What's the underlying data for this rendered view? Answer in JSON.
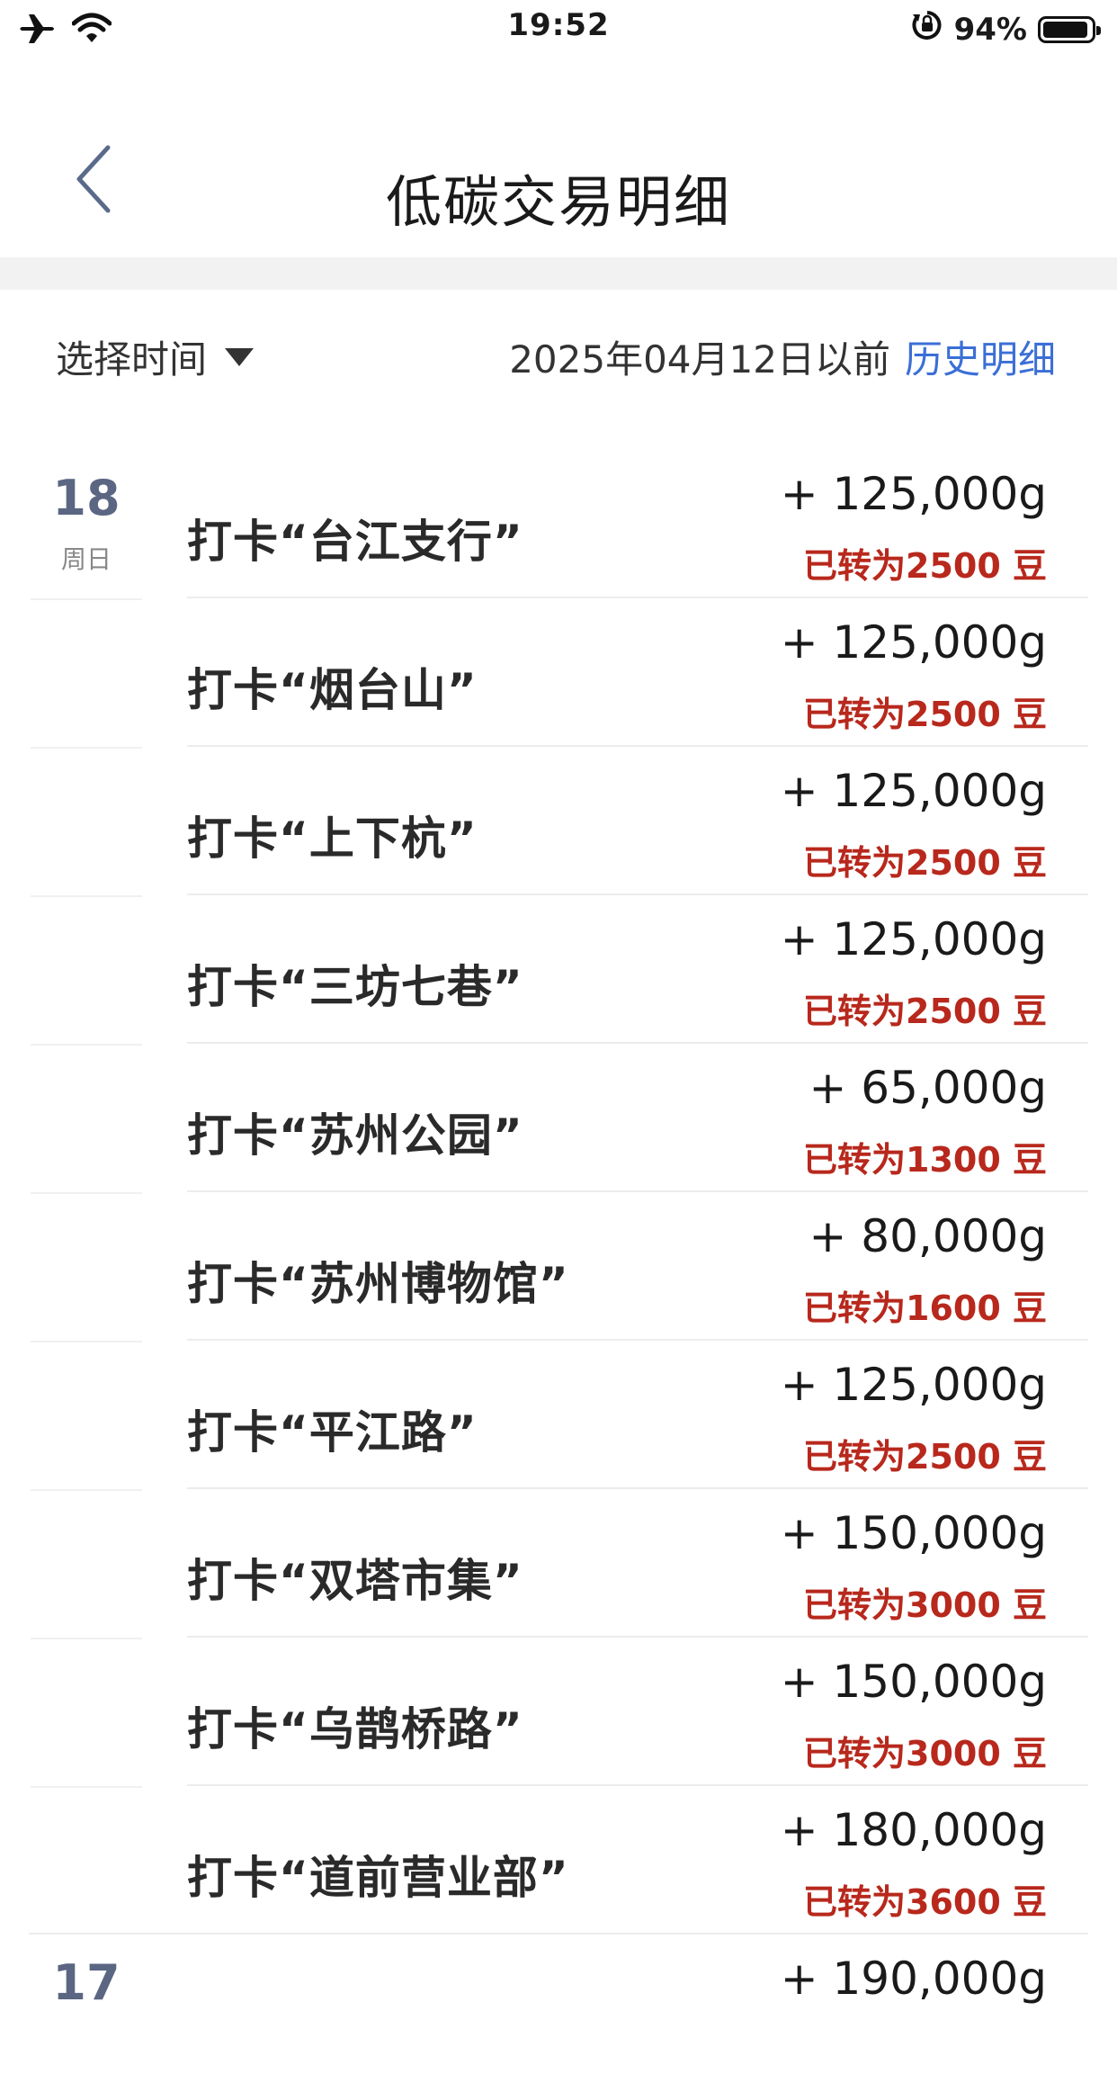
{
  "status_bar": {
    "time": "19:52",
    "battery_text": "94%",
    "battery_level": 0.94,
    "icons": [
      "airplane-icon",
      "wifi-icon",
      "orientation-lock-icon",
      "battery-icon"
    ]
  },
  "nav": {
    "title": "低碳交易明细",
    "back_icon": "chevron-left-icon"
  },
  "filter": {
    "select_label": "选择时间",
    "date_text": "2025年04月12日以前",
    "history_link": "历史明细"
  },
  "colors": {
    "accent_blue": "#3b6fd6",
    "bean_red": "#b8281c",
    "date_gray_blue": "#5b6683"
  },
  "groups": [
    {
      "day": "18",
      "weekday": "周日",
      "items": [
        {
          "title": "打卡“台江支行”",
          "amount": "+ 125,000g",
          "bean": "已转为2500 豆"
        },
        {
          "title": "打卡“烟台山”",
          "amount": "+ 125,000g",
          "bean": "已转为2500 豆"
        },
        {
          "title": "打卡“上下杭”",
          "amount": "+ 125,000g",
          "bean": "已转为2500 豆"
        },
        {
          "title": "打卡“三坊七巷”",
          "amount": "+ 125,000g",
          "bean": "已转为2500 豆"
        },
        {
          "title": "打卡“苏州公园”",
          "amount": "+ 65,000g",
          "bean": "已转为1300 豆"
        },
        {
          "title": "打卡“苏州博物馆”",
          "amount": "+ 80,000g",
          "bean": "已转为1600 豆"
        },
        {
          "title": "打卡“平江路”",
          "amount": "+ 125,000g",
          "bean": "已转为2500 豆"
        },
        {
          "title": "打卡“双塔市集”",
          "amount": "+ 150,000g",
          "bean": "已转为3000 豆"
        },
        {
          "title": "打卡“乌鹊桥路”",
          "amount": "+ 150,000g",
          "bean": "已转为3000 豆"
        },
        {
          "title": "打卡“道前营业部”",
          "amount": "+ 180,000g",
          "bean": "已转为3600 豆"
        }
      ]
    },
    {
      "day": "17",
      "items": [
        {
          "amount": "+ 190,000g"
        }
      ]
    }
  ]
}
